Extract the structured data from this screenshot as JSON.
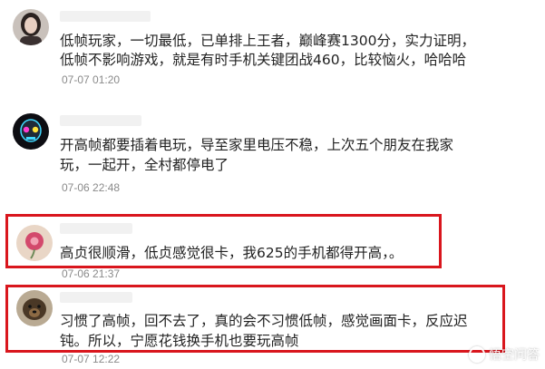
{
  "comments": [
    {
      "line1": "低帧玩家，一切最低，已单排上王者，巅峰赛1300分，实力证明，",
      "line2": "低帧不影响游戏，就是有时手机关键团战460，比较恼火，哈哈哈",
      "time": "07-07 01:20",
      "avatar": "woman-portrait-icon"
    },
    {
      "line1": "开高帧都要插着电玩，导至家里电压不稳，上次五个朋友在我家",
      "line2": "玩，一起开，全村都停电了",
      "time": "07-06 22:48",
      "avatar": "neon-skull-icon"
    },
    {
      "line1": "高贞很顺滑，低贞感觉很卡，我625的手机都得开高，。",
      "time": "07-06 21:37",
      "avatar": "flower-icon",
      "highlighted": true
    },
    {
      "line1": "习惯了高帧，回不去了，真的会不习惯低帧，感觉画面卡，反应迟",
      "line2": "钝。所以，宁愿花钱换手机也要玩高帧",
      "time": "07-07 12:22",
      "avatar": "dog-icon",
      "highlighted": true
    }
  ],
  "colors": {
    "highlight_border": "#d9161d",
    "text": "#222222",
    "time": "#8a8a8a"
  },
  "watermark": {
    "text": "悟空问答",
    "icon": "wukong-logo-icon"
  }
}
